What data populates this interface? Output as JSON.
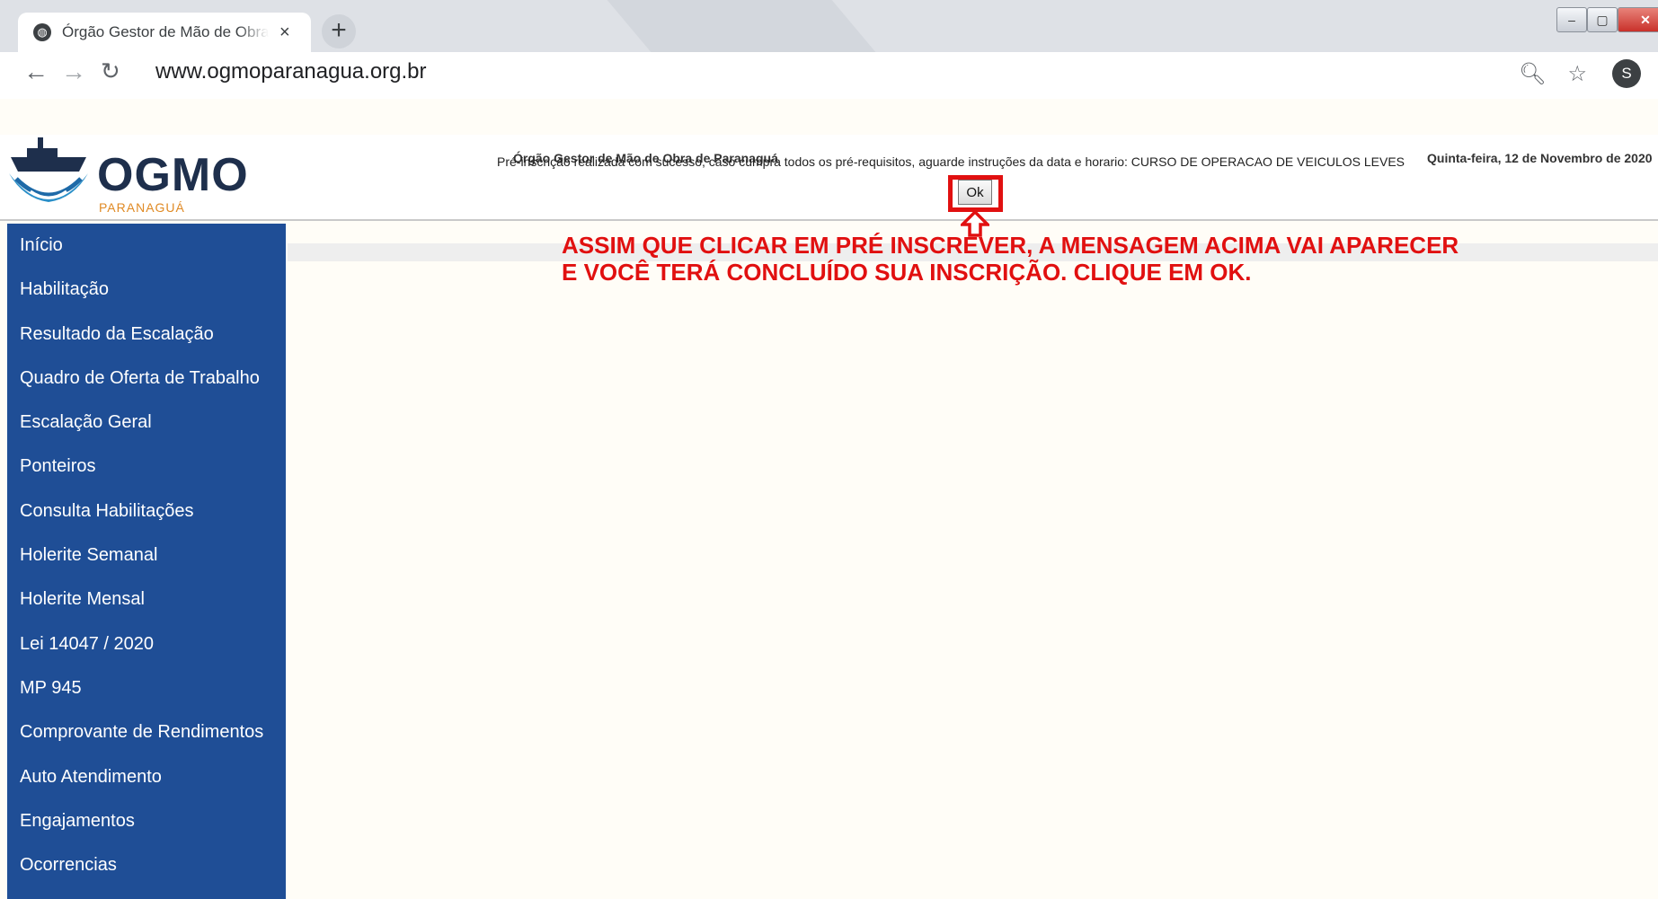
{
  "browser": {
    "tab_title": "Órgão Gestor de Mão de Obra de Paranaguá",
    "favicon": "globe-icon",
    "close_tab": "×",
    "new_tab": "+",
    "url": "www.ogmoparanagua.org.br",
    "profile_initial": "S",
    "icons": [
      "back-icon",
      "forward-icon",
      "reload-icon",
      "zoom-icon",
      "star-icon",
      "menu-dots-icon"
    ]
  },
  "header": {
    "logo_text": "OGMO",
    "logo_subtext": "PARANAGUÁ",
    "org_name": "Órgão Gestor de Mão de Obra de Paranaguá",
    "date": "Quinta-feira, 12 de Novembro de 2020"
  },
  "sidebar": {
    "items": [
      {
        "label": "Início"
      },
      {
        "label": "Habilitação"
      },
      {
        "label": "Resultado da Escalação"
      },
      {
        "label": "Quadro de Oferta de Trabalho"
      },
      {
        "label": "Escalação Geral"
      },
      {
        "label": "Ponteiros"
      },
      {
        "label": "Consulta Habilitações"
      },
      {
        "label": "Holerite Semanal"
      },
      {
        "label": "Holerite Mensal"
      },
      {
        "label": "Lei 14047 / 2020"
      },
      {
        "label": "MP 945"
      },
      {
        "label": "Comprovante de Rendimentos"
      },
      {
        "label": "Auto Atendimento"
      },
      {
        "label": "Engajamentos"
      },
      {
        "label": "Ocorrencias"
      }
    ]
  },
  "main": {
    "message": "Pré-inscrição realizada com sucesso, caso cumpra todos os pré-requisitos, aguarde instruções da data e horario: CURSO DE OPERACAO DE VEICULOS LEVES",
    "ok_label": "Ok",
    "annotation_line1": "ASSIM QUE CLICAR EM PRÉ INSCREVER, A MENSAGEM ACIMA VAI APARECER",
    "annotation_line2": "E VOCÊ TERÁ CONCLUÍDO SUA INSCRIÇÃO. CLIQUE EM OK."
  },
  "colors": {
    "sidebar_bg": "#1f4e96",
    "annotation_red": "#e11010",
    "page_bg": "#fffdf7"
  }
}
